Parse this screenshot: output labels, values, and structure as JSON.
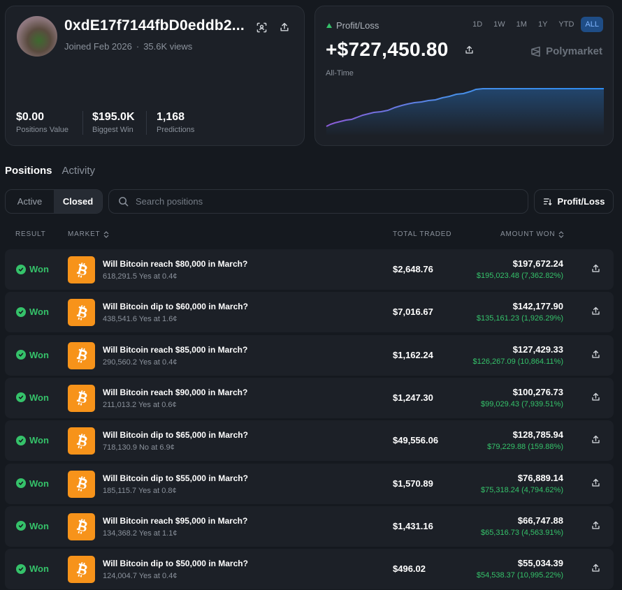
{
  "profile": {
    "username": "0xdE17f7144fbD0eddb2...",
    "joined": "Joined Feb 2026",
    "separator": "·",
    "views": "35.6K views",
    "stats": [
      {
        "value": "$0.00",
        "label": "Positions Value"
      },
      {
        "value": "$195.0K",
        "label": "Biggest Win"
      },
      {
        "value": "1,168",
        "label": "Predictions"
      }
    ]
  },
  "pnl": {
    "label": "Profit/Loss",
    "value": "+$727,450.80",
    "range_label": "All-Time",
    "brand": "Polymarket",
    "periods": [
      "1D",
      "1W",
      "1M",
      "1Y",
      "YTD",
      "ALL"
    ],
    "active_period": "ALL"
  },
  "tabs": {
    "positions": "Positions",
    "activity": "Activity",
    "active": "Positions"
  },
  "filter": {
    "active": "Active",
    "closed": "Closed",
    "selected": "Closed"
  },
  "search": {
    "placeholder": "Search positions"
  },
  "sort": {
    "label": "Profit/Loss"
  },
  "table": {
    "headers": {
      "result": "RESULT",
      "market": "MARKET",
      "total_traded": "TOTAL TRADED",
      "amount_won": "AMOUNT WON"
    },
    "rows": [
      {
        "result": "Won",
        "title": "Will Bitcoin reach $80,000 in March?",
        "sub": "618,291.5 Yes at 0.4¢",
        "traded": "$2,648.76",
        "won": "$197,672.24",
        "gain": "$195,023.48 (7,362.82%)"
      },
      {
        "result": "Won",
        "title": "Will Bitcoin dip to $60,000 in March?",
        "sub": "438,541.6 Yes at 1.6¢",
        "traded": "$7,016.67",
        "won": "$142,177.90",
        "gain": "$135,161.23 (1,926.29%)"
      },
      {
        "result": "Won",
        "title": "Will Bitcoin reach $85,000 in March?",
        "sub": "290,560.2 Yes at 0.4¢",
        "traded": "$1,162.24",
        "won": "$127,429.33",
        "gain": "$126,267.09 (10,864.11%)"
      },
      {
        "result": "Won",
        "title": "Will Bitcoin reach $90,000 in March?",
        "sub": "211,013.2 Yes at 0.6¢",
        "traded": "$1,247.30",
        "won": "$100,276.73",
        "gain": "$99,029.43 (7,939.51%)"
      },
      {
        "result": "Won",
        "title": "Will Bitcoin dip to $65,000 in March?",
        "sub": "718,130.9 No at 6.9¢",
        "traded": "$49,556.06",
        "won": "$128,785.94",
        "gain": "$79,229.88 (159.88%)"
      },
      {
        "result": "Won",
        "title": "Will Bitcoin dip to $55,000 in March?",
        "sub": "185,115.7 Yes at 0.8¢",
        "traded": "$1,570.89",
        "won": "$76,889.14",
        "gain": "$75,318.24 (4,794.62%)"
      },
      {
        "result": "Won",
        "title": "Will Bitcoin reach $95,000 in March?",
        "sub": "134,368.2 Yes at 1.1¢",
        "traded": "$1,431.16",
        "won": "$66,747.88",
        "gain": "$65,316.73 (4,563.91%)"
      },
      {
        "result": "Won",
        "title": "Will Bitcoin dip to $50,000 in March?",
        "sub": "124,004.7 Yes at 0.4¢",
        "traded": "$496.02",
        "won": "$55,034.39",
        "gain": "$54,538.37 (10,995.22%)"
      }
    ]
  },
  "colors": {
    "positive": "#35c26a",
    "bitcoin": "#f7931a",
    "accent": "#1f4d86"
  },
  "icons": {
    "scan": "scan-icon",
    "share": "share-icon",
    "check": "check-circle-icon",
    "bitcoin": "bitcoin-icon",
    "search": "search-icon",
    "sort": "sort-icon",
    "sort_arrows": "sort-arrows-icon",
    "brand": "polymarket-logo-icon"
  }
}
